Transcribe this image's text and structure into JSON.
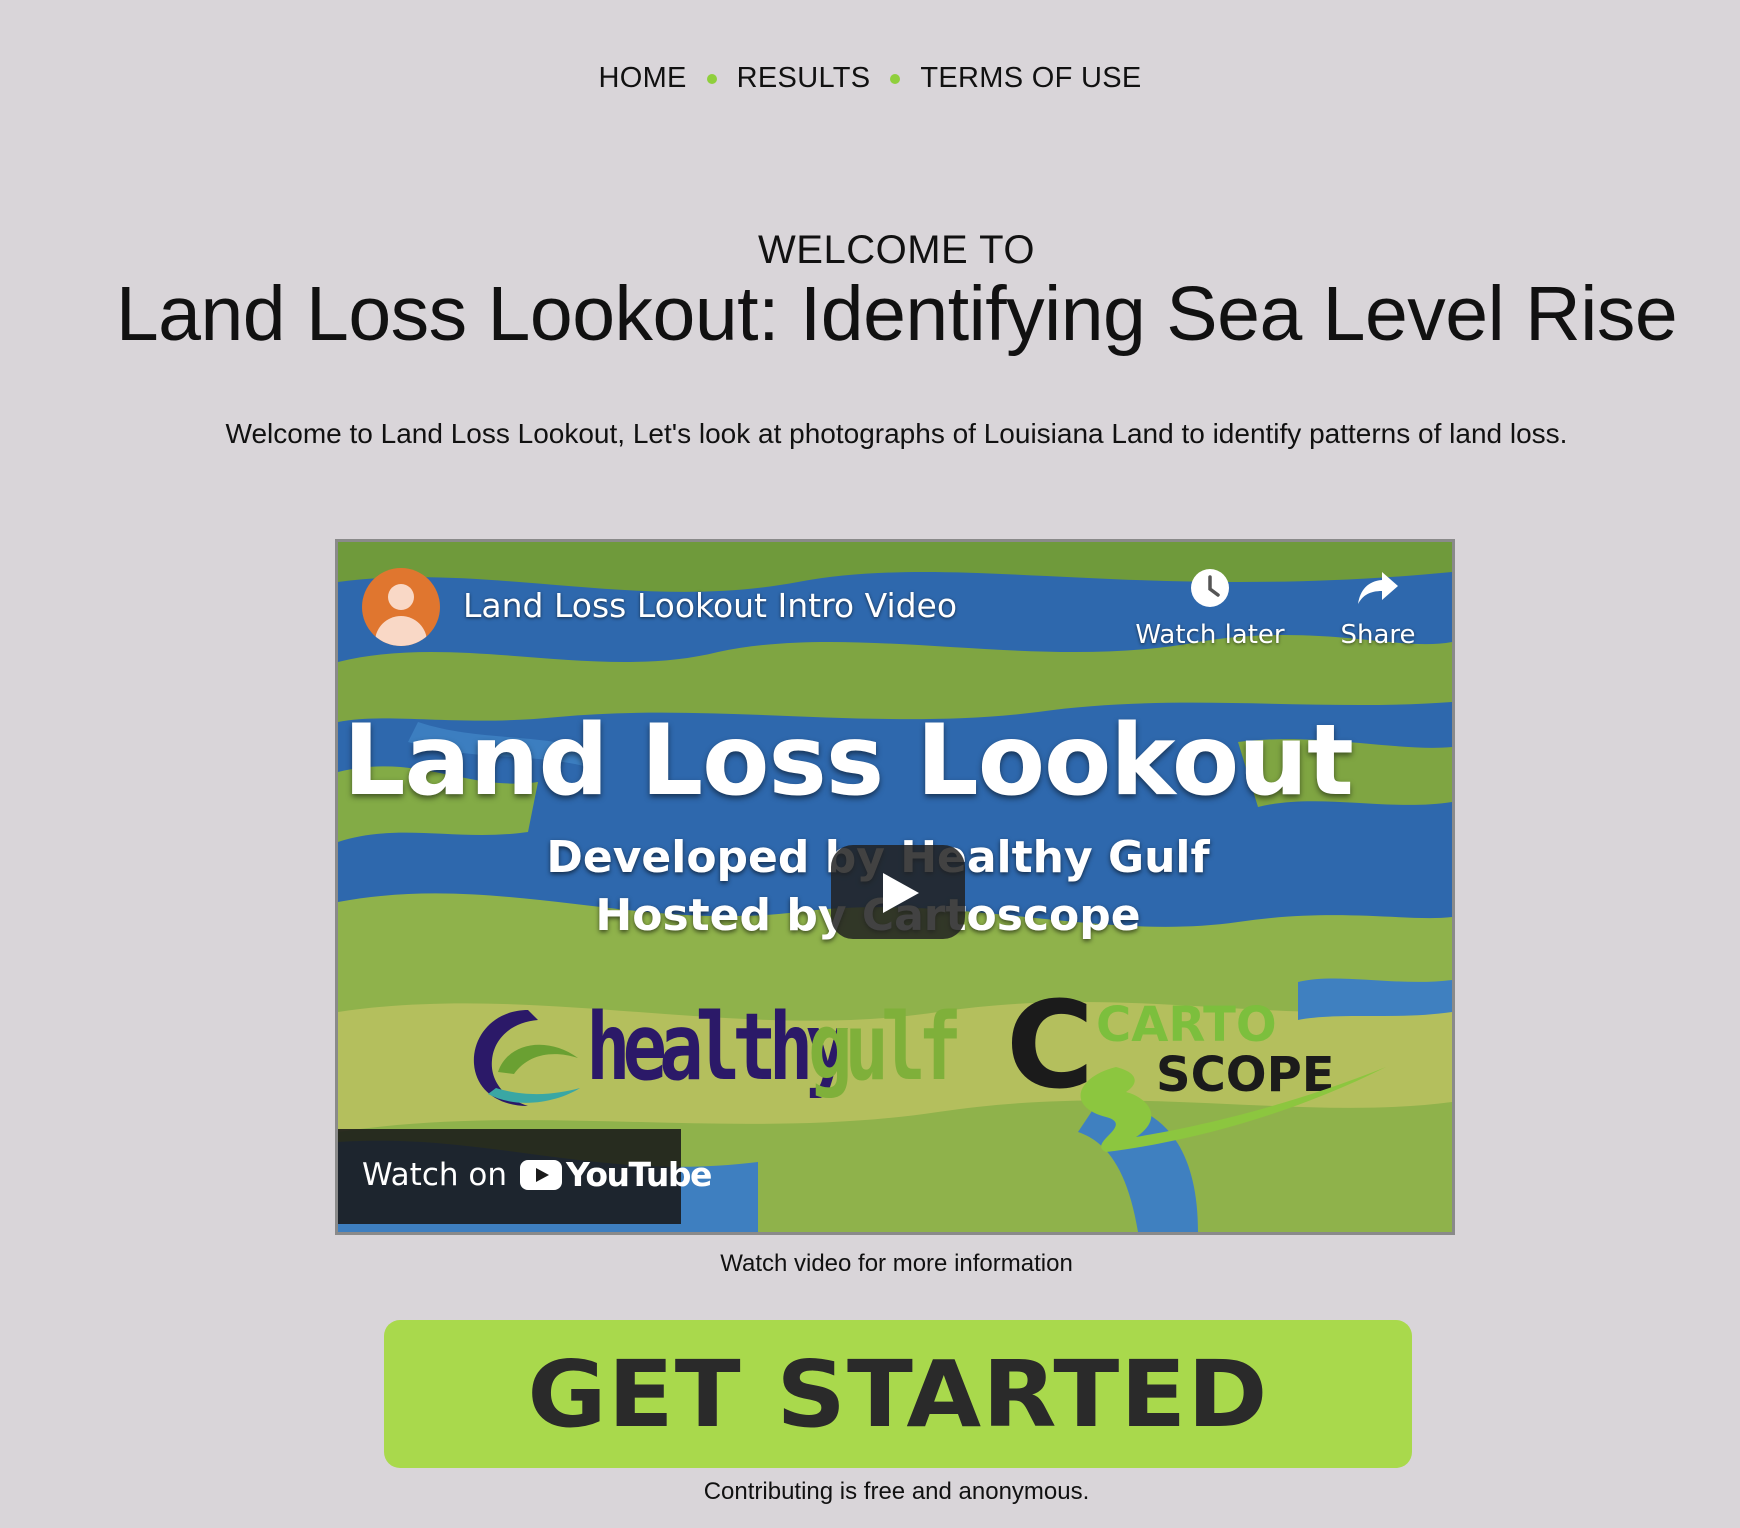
{
  "nav": {
    "items": [
      {
        "label": "HOME"
      },
      {
        "label": "RESULTS"
      },
      {
        "label": "TERMS OF USE"
      }
    ],
    "separator_color": "#8fcf3c"
  },
  "hero": {
    "kicker": "WELCOME TO",
    "title": "Land Loss Lookout: Identifying Sea Level Rise",
    "intro": "Welcome to Land Loss Lookout, Let's look at photographs of Louisiana Land to identify patterns of land loss."
  },
  "video": {
    "player_title": "Land Loss Lookout Intro Video",
    "watch_later_label": "Watch later",
    "share_label": "Share",
    "overlay_title": "Land Loss Lookout",
    "overlay_line1": "Developed by Healthy Gulf",
    "overlay_line2": "Hosted by Cartoscope",
    "logo_healthy": "healthy",
    "logo_gulf": "gulf",
    "logo_carto_c": "C",
    "logo_carto": "CARTO",
    "logo_scope": "SCOPE",
    "watch_on_label": "Watch on",
    "youtube_label": "YouTube",
    "caption": "Watch video for more information"
  },
  "cta": {
    "label": "GET STARTED",
    "color": "#a9d94c",
    "note": "Contributing is free and anonymous."
  }
}
